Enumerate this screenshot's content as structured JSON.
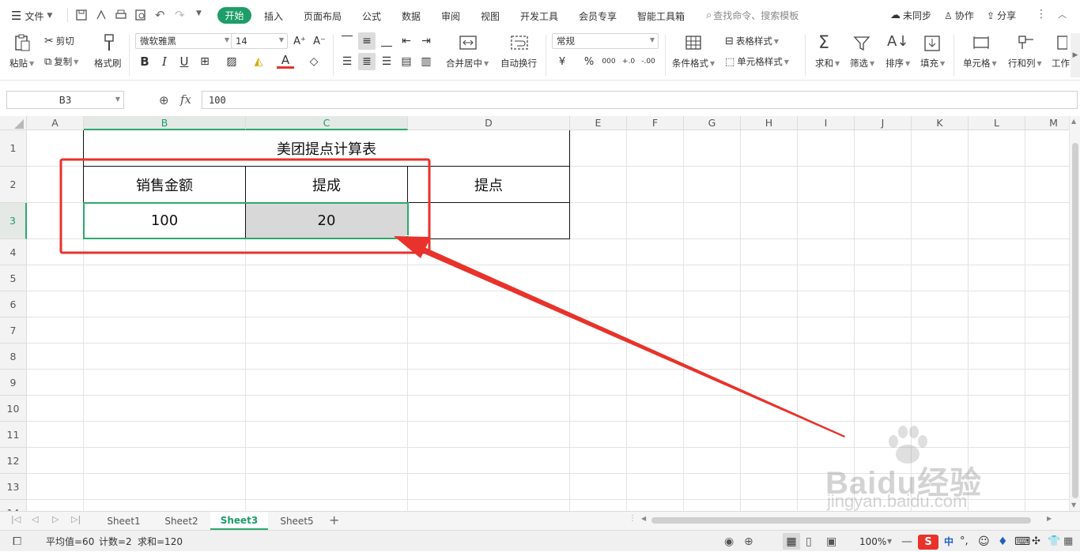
{
  "menubar": {
    "file_label": "文件",
    "tabs": [
      "开始",
      "插入",
      "页面布局",
      "公式",
      "数据",
      "审阅",
      "视图",
      "开发工具",
      "会员专享",
      "智能工具箱"
    ],
    "active_tab": "开始",
    "search_placeholder": "查找命令、搜索模板",
    "sync_label": "未同步",
    "collab_label": "协作",
    "share_label": "分享"
  },
  "ribbon": {
    "paste": "粘贴",
    "cut": "剪切",
    "copy": "复制",
    "format_painter": "格式刷",
    "font_name": "微软雅黑",
    "font_size": "14",
    "merge_center": "合并居中",
    "wrap_text": "自动换行",
    "number_format": "常规",
    "cond_format": "条件格式",
    "table_style": "表格样式",
    "cell_style": "单元格样式",
    "sum": "求和",
    "filter": "筛选",
    "sort": "排序",
    "fill": "填充",
    "cells": "单元格",
    "row_col": "行和列",
    "worksheet": "工作"
  },
  "formula_bar": {
    "name_box": "B3",
    "fx": "fx",
    "content": "100"
  },
  "grid": {
    "columns": [
      "A",
      "B",
      "C",
      "D",
      "E",
      "F",
      "G",
      "H",
      "I",
      "J",
      "K",
      "L",
      "M"
    ],
    "rows": [
      "1",
      "2",
      "3",
      "4",
      "5",
      "6",
      "7",
      "8",
      "9",
      "10",
      "11",
      "12",
      "13",
      "14"
    ],
    "title": "美团提点计算表",
    "headers": [
      "销售金额",
      "提成",
      "提点"
    ],
    "values": [
      "100",
      "20",
      ""
    ]
  },
  "sheets": {
    "tabs": [
      "Sheet1",
      "Sheet2",
      "Sheet3",
      "Sheet5"
    ],
    "active": "Sheet3"
  },
  "status": {
    "average": "平均值=60",
    "count": "计数=2",
    "sum": "求和=120",
    "zoom": "100%",
    "ime_lang": "中"
  },
  "watermark": {
    "brand": "Baidu经验",
    "url": "jingyan.baidu.com"
  },
  "colors": {
    "accent": "#1e9d68",
    "annotation": "#e8322b",
    "selection_fill": "#d8d8d8"
  }
}
